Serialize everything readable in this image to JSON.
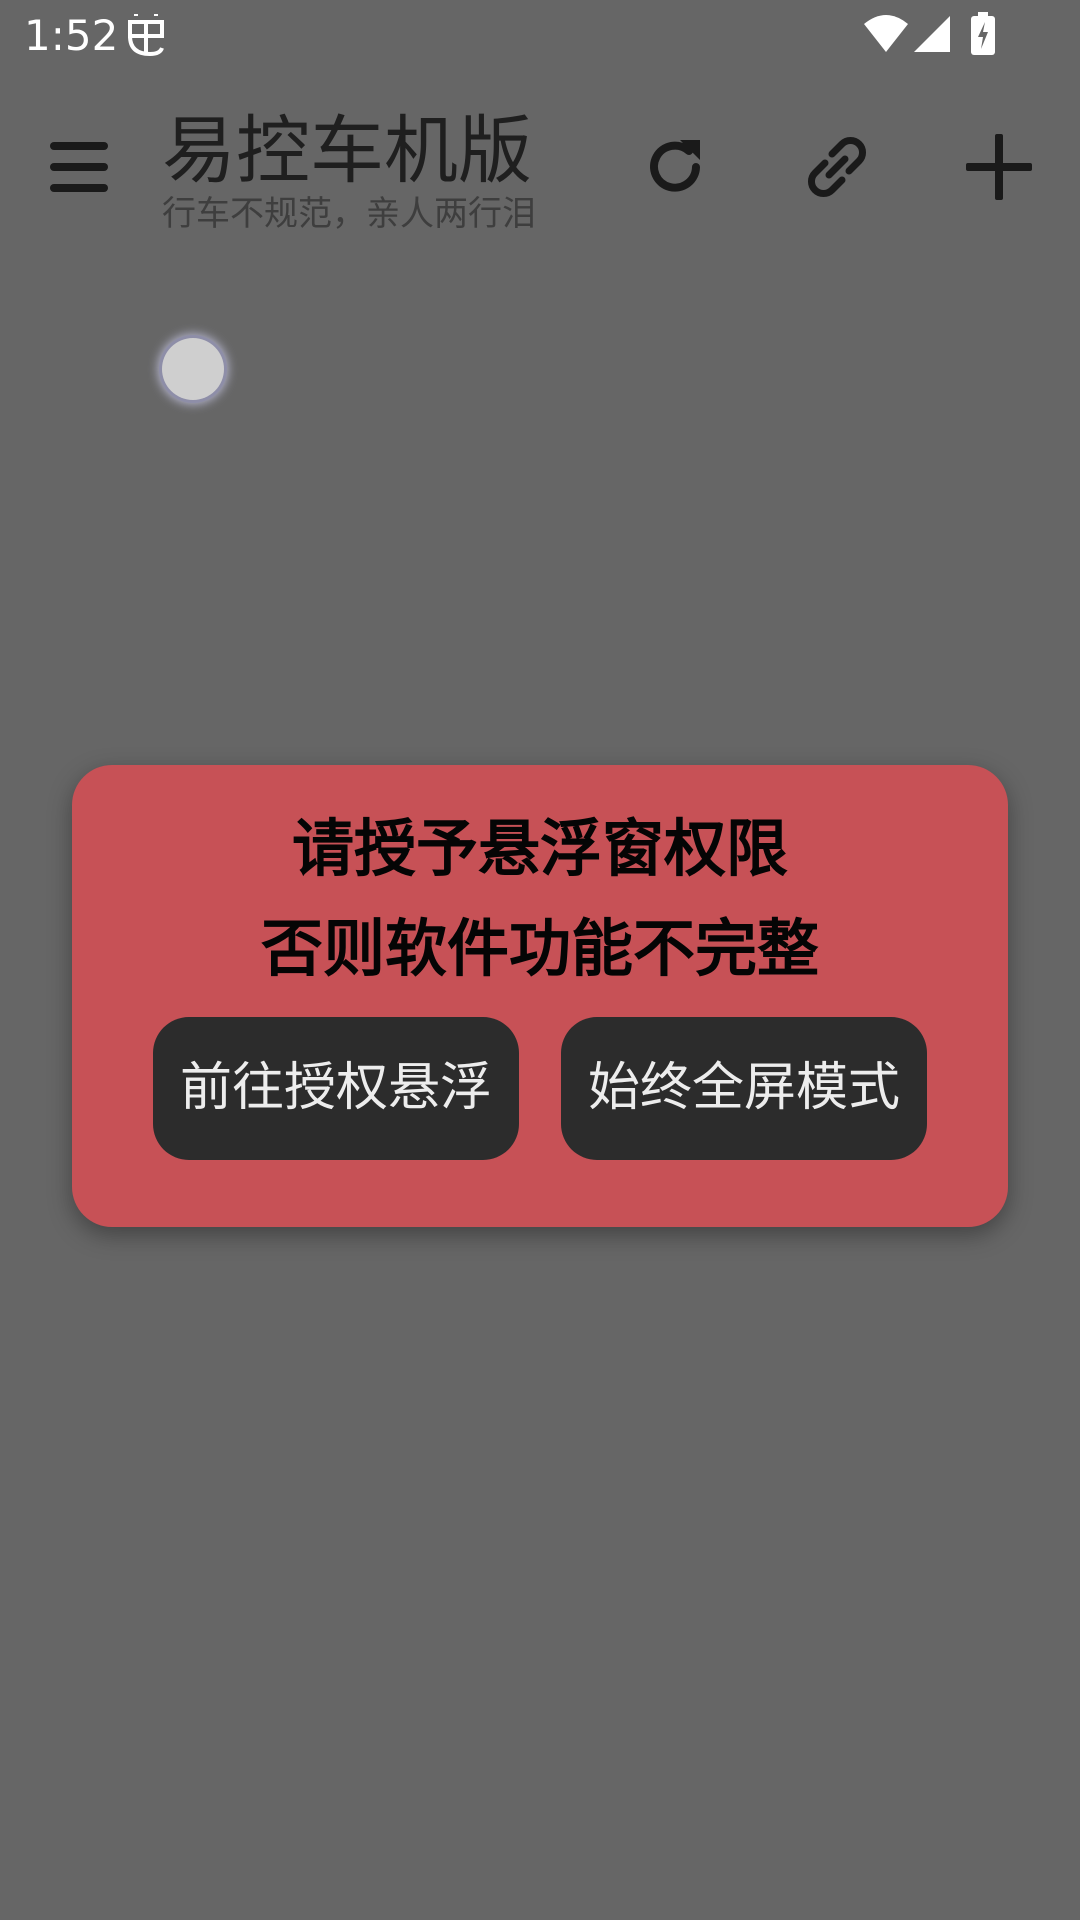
{
  "status_bar": {
    "time": "1:52",
    "debug_icon": "bug-icon",
    "wifi_icon": "wifi-icon",
    "signal_icon": "cell-signal-icon",
    "battery_icon": "battery-charging-icon"
  },
  "toolbar": {
    "title": "易控车机版",
    "subtitle": "行车不规范，亲人两行泪",
    "menu_icon": "hamburger-menu-icon",
    "refresh_icon": "refresh-icon",
    "link_icon": "link-icon",
    "add_icon": "plus-icon"
  },
  "dialog": {
    "title_line1": "请授予悬浮窗权限",
    "title_line2": "否则软件功能不完整",
    "button_grant": "前往授权悬浮",
    "button_fullscreen": "始终全屏模式"
  },
  "colors": {
    "background": "#666666",
    "dialog_bg": "#c75156",
    "button_bg": "#2c2c2c",
    "button_text": "#ededed"
  }
}
